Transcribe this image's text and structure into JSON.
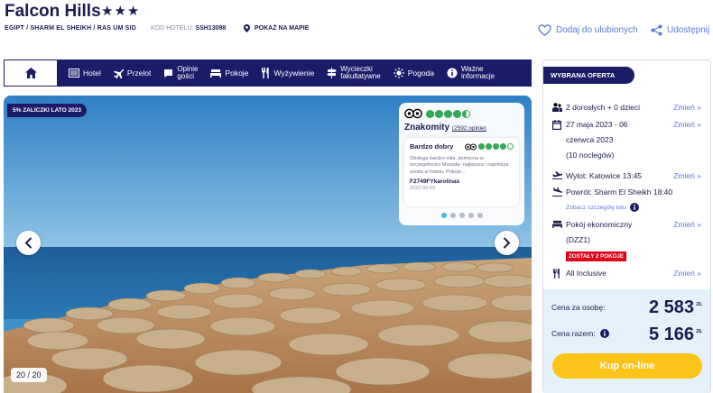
{
  "hotel": {
    "name": "Falcon Hills",
    "stars": "★★★",
    "breadcrumb": "EGIPT / SHARM EL SHEIKH / RAS UM SID",
    "code_label": "KOD HOTELU:",
    "code_value": "SSH13098",
    "map_link": "POKAŻ NA MAPIE",
    "favorite": "Dodaj do ulubionych",
    "share": "Udostępnij"
  },
  "nav": {
    "items": [
      {
        "label": "Hotel",
        "icon": "hotel-icon"
      },
      {
        "label": "Przelot",
        "icon": "plane-icon"
      },
      {
        "label": "Opinie\ngości",
        "icon": "comment-icon"
      },
      {
        "label": "Pokoje",
        "icon": "bed-icon"
      },
      {
        "label": "Wyżywienie",
        "icon": "cutlery-icon"
      },
      {
        "label": "Wycieczki\nfakultatywne",
        "icon": "signpost-icon"
      },
      {
        "label": "Pogoda",
        "icon": "sun-icon"
      },
      {
        "label": "Ważne\ninformacje",
        "icon": "info-icon"
      }
    ]
  },
  "gallery": {
    "promo": "5% ZALICZKI LATO 2023",
    "counter": "20 / 20",
    "tripadvisor": {
      "rating_word": "Znakomity",
      "reviews_link": "(2592 opinie)",
      "rating": 4.5,
      "review": {
        "title": "Bardzo dobry",
        "text": "Obsługa bardzo miła, pomocna w szczególności Mostafa- najlepsza i najmilsza osoba w hotelu, Pokoje...",
        "user": "F2749FYkarolinas",
        "date": "2022-09-03"
      },
      "pages": 5,
      "active_page": 1
    }
  },
  "offer": {
    "badge": "WYBRANA OFERTA",
    "people": "2 dorosłych + 0 dzieci",
    "dates_line1": "27 maja 2023 - 06",
    "dates_line2": "czerwca 2023",
    "nights": "(10 noclegów)",
    "departure": "Wylot: Katowice 13:45",
    "return": "Powrót: Sharm El Sheikh 18:40",
    "flight_details": "Zobacz szczegóły lotu",
    "room_line1": "Pokój ekonomiczny",
    "room_line2": "(DZZ1)",
    "rooms_left": "ZOSTAŁY 2 POKOJE",
    "board": "All Inclusive",
    "change": "Zmień  »",
    "price_per_person_label": "Cena za osobę:",
    "price_per_person": "2 583",
    "price_total_label": "Cena razem:",
    "price_total": "5 166",
    "currency": "ZŁ",
    "buy_button": "Kup on-line"
  },
  "colors": {
    "navy": "#1b1c68",
    "link": "#5a7bd4",
    "accent_yellow": "#fcc419",
    "alert_red": "#e3001b",
    "price_bg": "#e4f1fb"
  }
}
